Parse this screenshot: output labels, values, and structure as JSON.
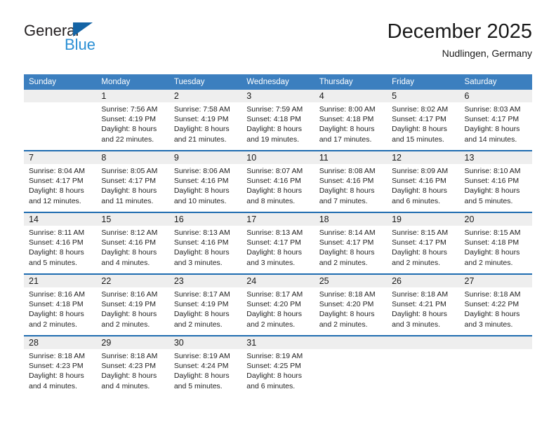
{
  "brand": {
    "name_part1": "General",
    "name_part2": "Blue",
    "triangle_color": "#1464a5",
    "blue_text_color": "#2b8fd4"
  },
  "header": {
    "title": "December 2025",
    "subtitle": "Nudlingen, Germany"
  },
  "theme": {
    "header_row_bg": "#3c7fbf",
    "week_separator": "#1f6cb0",
    "daynum_band_bg": "#eeeeee"
  },
  "calendar": {
    "weekday_headers": [
      "Sunday",
      "Monday",
      "Tuesday",
      "Wednesday",
      "Thursday",
      "Friday",
      "Saturday"
    ],
    "weeks": [
      [
        {
          "day": "",
          "sunrise": "",
          "sunset": "",
          "daylight_line1": "",
          "daylight_line2": ""
        },
        {
          "day": "1",
          "sunrise": "Sunrise: 7:56 AM",
          "sunset": "Sunset: 4:19 PM",
          "daylight_line1": "Daylight: 8 hours",
          "daylight_line2": "and 22 minutes."
        },
        {
          "day": "2",
          "sunrise": "Sunrise: 7:58 AM",
          "sunset": "Sunset: 4:19 PM",
          "daylight_line1": "Daylight: 8 hours",
          "daylight_line2": "and 21 minutes."
        },
        {
          "day": "3",
          "sunrise": "Sunrise: 7:59 AM",
          "sunset": "Sunset: 4:18 PM",
          "daylight_line1": "Daylight: 8 hours",
          "daylight_line2": "and 19 minutes."
        },
        {
          "day": "4",
          "sunrise": "Sunrise: 8:00 AM",
          "sunset": "Sunset: 4:18 PM",
          "daylight_line1": "Daylight: 8 hours",
          "daylight_line2": "and 17 minutes."
        },
        {
          "day": "5",
          "sunrise": "Sunrise: 8:02 AM",
          "sunset": "Sunset: 4:17 PM",
          "daylight_line1": "Daylight: 8 hours",
          "daylight_line2": "and 15 minutes."
        },
        {
          "day": "6",
          "sunrise": "Sunrise: 8:03 AM",
          "sunset": "Sunset: 4:17 PM",
          "daylight_line1": "Daylight: 8 hours",
          "daylight_line2": "and 14 minutes."
        }
      ],
      [
        {
          "day": "7",
          "sunrise": "Sunrise: 8:04 AM",
          "sunset": "Sunset: 4:17 PM",
          "daylight_line1": "Daylight: 8 hours",
          "daylight_line2": "and 12 minutes."
        },
        {
          "day": "8",
          "sunrise": "Sunrise: 8:05 AM",
          "sunset": "Sunset: 4:17 PM",
          "daylight_line1": "Daylight: 8 hours",
          "daylight_line2": "and 11 minutes."
        },
        {
          "day": "9",
          "sunrise": "Sunrise: 8:06 AM",
          "sunset": "Sunset: 4:16 PM",
          "daylight_line1": "Daylight: 8 hours",
          "daylight_line2": "and 10 minutes."
        },
        {
          "day": "10",
          "sunrise": "Sunrise: 8:07 AM",
          "sunset": "Sunset: 4:16 PM",
          "daylight_line1": "Daylight: 8 hours",
          "daylight_line2": "and 8 minutes."
        },
        {
          "day": "11",
          "sunrise": "Sunrise: 8:08 AM",
          "sunset": "Sunset: 4:16 PM",
          "daylight_line1": "Daylight: 8 hours",
          "daylight_line2": "and 7 minutes."
        },
        {
          "day": "12",
          "sunrise": "Sunrise: 8:09 AM",
          "sunset": "Sunset: 4:16 PM",
          "daylight_line1": "Daylight: 8 hours",
          "daylight_line2": "and 6 minutes."
        },
        {
          "day": "13",
          "sunrise": "Sunrise: 8:10 AM",
          "sunset": "Sunset: 4:16 PM",
          "daylight_line1": "Daylight: 8 hours",
          "daylight_line2": "and 5 minutes."
        }
      ],
      [
        {
          "day": "14",
          "sunrise": "Sunrise: 8:11 AM",
          "sunset": "Sunset: 4:16 PM",
          "daylight_line1": "Daylight: 8 hours",
          "daylight_line2": "and 5 minutes."
        },
        {
          "day": "15",
          "sunrise": "Sunrise: 8:12 AM",
          "sunset": "Sunset: 4:16 PM",
          "daylight_line1": "Daylight: 8 hours",
          "daylight_line2": "and 4 minutes."
        },
        {
          "day": "16",
          "sunrise": "Sunrise: 8:13 AM",
          "sunset": "Sunset: 4:16 PM",
          "daylight_line1": "Daylight: 8 hours",
          "daylight_line2": "and 3 minutes."
        },
        {
          "day": "17",
          "sunrise": "Sunrise: 8:13 AM",
          "sunset": "Sunset: 4:17 PM",
          "daylight_line1": "Daylight: 8 hours",
          "daylight_line2": "and 3 minutes."
        },
        {
          "day": "18",
          "sunrise": "Sunrise: 8:14 AM",
          "sunset": "Sunset: 4:17 PM",
          "daylight_line1": "Daylight: 8 hours",
          "daylight_line2": "and 2 minutes."
        },
        {
          "day": "19",
          "sunrise": "Sunrise: 8:15 AM",
          "sunset": "Sunset: 4:17 PM",
          "daylight_line1": "Daylight: 8 hours",
          "daylight_line2": "and 2 minutes."
        },
        {
          "day": "20",
          "sunrise": "Sunrise: 8:15 AM",
          "sunset": "Sunset: 4:18 PM",
          "daylight_line1": "Daylight: 8 hours",
          "daylight_line2": "and 2 minutes."
        }
      ],
      [
        {
          "day": "21",
          "sunrise": "Sunrise: 8:16 AM",
          "sunset": "Sunset: 4:18 PM",
          "daylight_line1": "Daylight: 8 hours",
          "daylight_line2": "and 2 minutes."
        },
        {
          "day": "22",
          "sunrise": "Sunrise: 8:16 AM",
          "sunset": "Sunset: 4:19 PM",
          "daylight_line1": "Daylight: 8 hours",
          "daylight_line2": "and 2 minutes."
        },
        {
          "day": "23",
          "sunrise": "Sunrise: 8:17 AM",
          "sunset": "Sunset: 4:19 PM",
          "daylight_line1": "Daylight: 8 hours",
          "daylight_line2": "and 2 minutes."
        },
        {
          "day": "24",
          "sunrise": "Sunrise: 8:17 AM",
          "sunset": "Sunset: 4:20 PM",
          "daylight_line1": "Daylight: 8 hours",
          "daylight_line2": "and 2 minutes."
        },
        {
          "day": "25",
          "sunrise": "Sunrise: 8:18 AM",
          "sunset": "Sunset: 4:20 PM",
          "daylight_line1": "Daylight: 8 hours",
          "daylight_line2": "and 2 minutes."
        },
        {
          "day": "26",
          "sunrise": "Sunrise: 8:18 AM",
          "sunset": "Sunset: 4:21 PM",
          "daylight_line1": "Daylight: 8 hours",
          "daylight_line2": "and 3 minutes."
        },
        {
          "day": "27",
          "sunrise": "Sunrise: 8:18 AM",
          "sunset": "Sunset: 4:22 PM",
          "daylight_line1": "Daylight: 8 hours",
          "daylight_line2": "and 3 minutes."
        }
      ],
      [
        {
          "day": "28",
          "sunrise": "Sunrise: 8:18 AM",
          "sunset": "Sunset: 4:23 PM",
          "daylight_line1": "Daylight: 8 hours",
          "daylight_line2": "and 4 minutes."
        },
        {
          "day": "29",
          "sunrise": "Sunrise: 8:18 AM",
          "sunset": "Sunset: 4:23 PM",
          "daylight_line1": "Daylight: 8 hours",
          "daylight_line2": "and 4 minutes."
        },
        {
          "day": "30",
          "sunrise": "Sunrise: 8:19 AM",
          "sunset": "Sunset: 4:24 PM",
          "daylight_line1": "Daylight: 8 hours",
          "daylight_line2": "and 5 minutes."
        },
        {
          "day": "31",
          "sunrise": "Sunrise: 8:19 AM",
          "sunset": "Sunset: 4:25 PM",
          "daylight_line1": "Daylight: 8 hours",
          "daylight_line2": "and 6 minutes."
        },
        {
          "day": "",
          "sunrise": "",
          "sunset": "",
          "daylight_line1": "",
          "daylight_line2": ""
        },
        {
          "day": "",
          "sunrise": "",
          "sunset": "",
          "daylight_line1": "",
          "daylight_line2": ""
        },
        {
          "day": "",
          "sunrise": "",
          "sunset": "",
          "daylight_line1": "",
          "daylight_line2": ""
        }
      ]
    ]
  }
}
